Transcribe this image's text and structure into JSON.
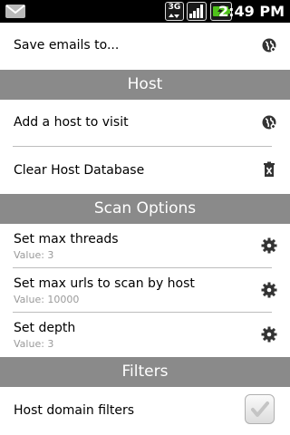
{
  "statusbar": {
    "network_label": "3G",
    "time": "2:49 PM",
    "icons": [
      "email-icon",
      "3g-icon",
      "signal-icon",
      "battery-icon"
    ]
  },
  "items": {
    "save_emails": {
      "title": "Save emails to..."
    },
    "host_header": "Host",
    "add_host": {
      "title": "Add a host to visit"
    },
    "clear_host_db": {
      "title": "Clear Host Database"
    },
    "scan_header": "Scan Options",
    "max_threads": {
      "title": "Set max threads",
      "value": "Value: 3"
    },
    "max_urls": {
      "title": "Set max urls to scan by host",
      "value": "Value: 10000"
    },
    "depth": {
      "title": "Set depth",
      "value": "Value: 3"
    },
    "filters_header": "Filters",
    "host_domain_filters": {
      "title": "Host domain filters",
      "checked": true
    }
  },
  "colors": {
    "header_bg": "#8a8a8a",
    "subtext": "#9a9a9a",
    "statusbar_bg": "#000000"
  }
}
